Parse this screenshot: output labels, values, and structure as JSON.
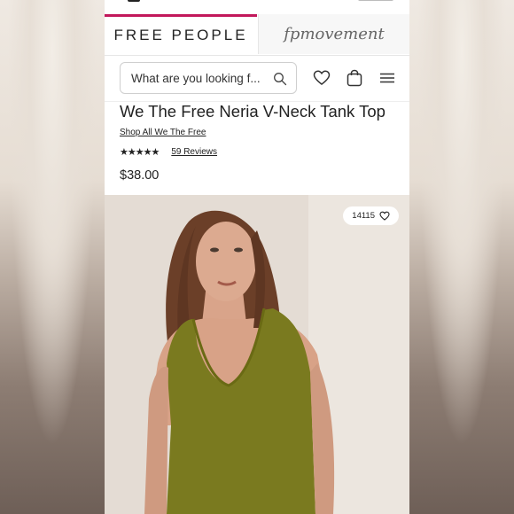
{
  "header": {
    "tabs": [
      {
        "label": "FREE PEOPLE",
        "active": true
      },
      {
        "label": "fpmovement",
        "active": false
      }
    ],
    "accent_color": "#c2185b"
  },
  "search": {
    "placeholder": "What are you looking f..."
  },
  "header_icons": [
    "heart-icon",
    "shopping-bag-icon",
    "hamburger-menu-icon",
    "search-icon"
  ],
  "product": {
    "title": "We The Free Neria V-Neck Tank Top",
    "shop_link": "Shop All We The Free",
    "stars": "★★★★★",
    "rating": 4.5,
    "reviews": "59 Reviews",
    "price": "$38.00",
    "likes": "14115"
  },
  "colors": {
    "tank_top": "#7a7a1f",
    "background": "#ffffff"
  }
}
